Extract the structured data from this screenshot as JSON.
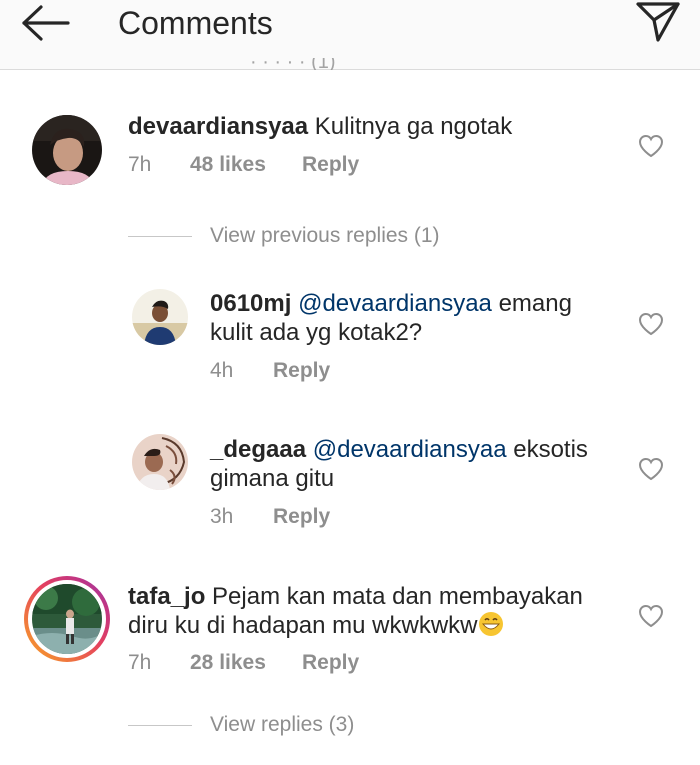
{
  "header": {
    "title": "Comments",
    "partial_text": "· · · · · (1)"
  },
  "comments": [
    {
      "username": "devaardiansyaa",
      "text": "Kulitnya ga ngotak",
      "time": "7h",
      "likes": "48 likes",
      "reply_label": "Reply",
      "view_replies_label": "View previous replies (1)",
      "replies": [
        {
          "username": "0610mj",
          "mention": "@devaardiansyaa",
          "text": "emang",
          "text_line2": "kulit ada yg kotak2?",
          "time": "4h",
          "reply_label": "Reply"
        },
        {
          "username": "_degaaa",
          "mention": "@devaardiansyaa",
          "text": "eksotis",
          "text_line2": "gimana gitu",
          "time": "3h",
          "reply_label": "Reply"
        }
      ]
    },
    {
      "username": "tafa_jo",
      "text": "Pejam kan mata dan membayakan",
      "text_line2": "diru ku di hadapan mu wkwkwkw",
      "time": "7h",
      "likes": "28 likes",
      "reply_label": "Reply",
      "view_replies_label": "View replies (3)"
    }
  ],
  "icons": {
    "back": "back-arrow-icon",
    "send": "paper-plane-icon",
    "heart": "heart-outline-icon",
    "emoji": "grinning-face-icon"
  },
  "colors": {
    "mention": "#003569",
    "muted": "#8e8e8e",
    "text": "#262626",
    "story_ring": "#e4405f"
  }
}
